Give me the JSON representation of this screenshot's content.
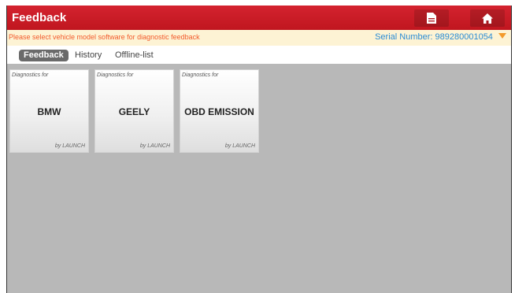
{
  "header": {
    "title": "Feedback",
    "report_icon": "report-document-icon",
    "home_icon": "home-icon",
    "accent_color": "#c8192a"
  },
  "info_bar": {
    "hint": "Please select vehicle model software for diagnostic feedback",
    "serial_label": "Serial Number:",
    "serial_value": "989280001054",
    "dropdown_icon": "caret-down-icon"
  },
  "tabs": [
    {
      "label": "Feedback",
      "active": true
    },
    {
      "label": "History",
      "active": false
    },
    {
      "label": "Offline-list",
      "active": false
    }
  ],
  "cards": [
    {
      "caption": "Diagnostics for",
      "name": "BMW",
      "vendor": "by LAUNCH"
    },
    {
      "caption": "Diagnostics for",
      "name": "GEELY",
      "vendor": "by LAUNCH"
    },
    {
      "caption": "Diagnostics for",
      "name": "OBD EMISSION",
      "vendor": "by LAUNCH"
    }
  ]
}
